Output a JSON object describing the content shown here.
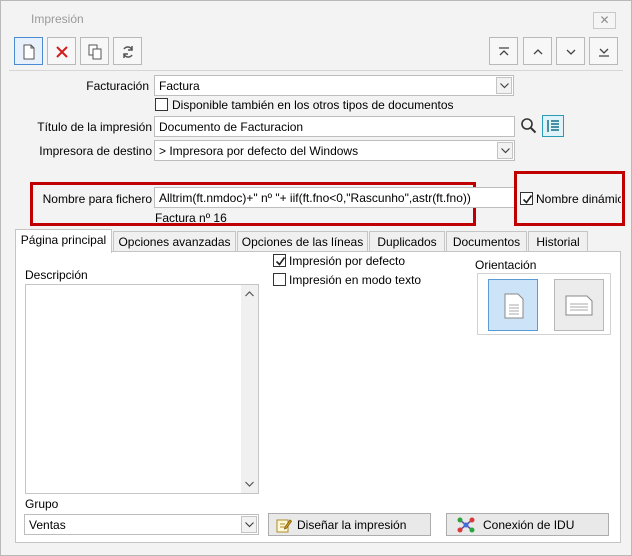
{
  "window": {
    "title": "Impresión",
    "close_glyph": "✕"
  },
  "toolbar": {
    "left_icons": [
      "new-document-icon",
      "delete-icon",
      "copy-icon",
      "refresh-icon"
    ],
    "right_icons": [
      "first-record-icon",
      "previous-record-icon",
      "next-record-icon",
      "last-record-icon"
    ]
  },
  "form": {
    "facturacion_label": "Facturación",
    "facturacion_value": "Factura",
    "disponible_label": "Disponible también en los otros tipos de documentos",
    "titulo_label": "Título de la impresión",
    "titulo_value": "Documento de Facturacion",
    "impresora_label": "Impresora de destino",
    "impresora_value": "> Impresora por defecto del Windows",
    "nombre_fichero_label": "Nombre para fichero",
    "nombre_fichero_value": "Alltrim(ft.nmdoc)+\" nº \"+ iif(ft.fno<0,\"Rascunho\",astr(ft.fno))",
    "nombre_fichero_preview": "Factura nº 16",
    "nombre_dinamico_label": "Nombre dinámico",
    "nombre_dinamico_checked": true
  },
  "tabs": [
    {
      "label": "Página principal"
    },
    {
      "label": "Opciones avanzadas"
    },
    {
      "label": "Opciones de las líneas"
    },
    {
      "label": "Duplicados"
    },
    {
      "label": "Documentos"
    },
    {
      "label": "Historial"
    }
  ],
  "main_tab": {
    "descripcion_label": "Descripción",
    "impresion_defecto_label": "Impresión por defecto",
    "impresion_defecto_checked": true,
    "impresion_texto_label": "Impresión en modo texto",
    "impresion_texto_checked": false,
    "orientacion_label": "Orientación",
    "orientacion_selected": "portrait",
    "grupo_label": "Grupo",
    "grupo_value": "Ventas",
    "disenar_button": "Diseñar la impresión",
    "conexion_button": "Conexión de IDU"
  },
  "colors": {
    "highlight": "#c00000",
    "selected": "#cde3f7"
  }
}
